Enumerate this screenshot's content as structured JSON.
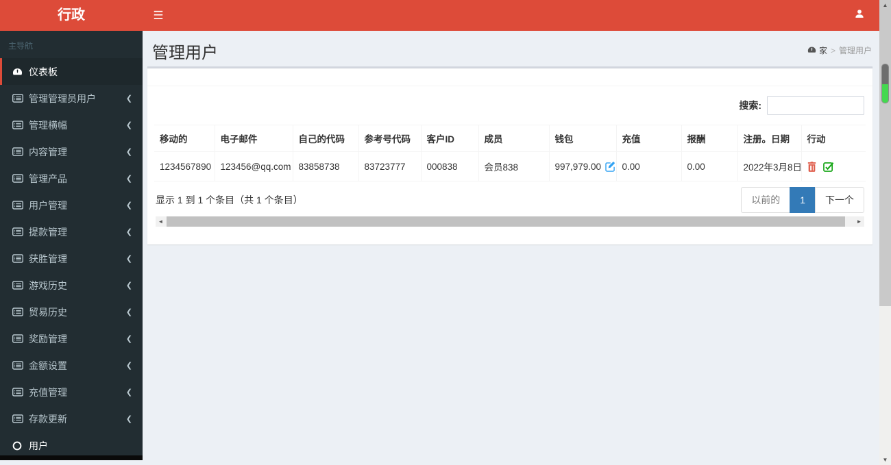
{
  "navbar": {
    "logo": "行政",
    "icons": {
      "menu": "hamburger-icon",
      "user": "user-icon"
    }
  },
  "sidebar": {
    "section_label": "主导航",
    "items": [
      {
        "label": "仪表板",
        "icon": "gauge-icon",
        "active": true,
        "has_children": false
      },
      {
        "label": "管理管理员用户",
        "icon": "list-alt-icon",
        "active": false,
        "has_children": true
      },
      {
        "label": "管理横幅",
        "icon": "list-alt-icon",
        "active": false,
        "has_children": true
      },
      {
        "label": "内容管理",
        "icon": "list-alt-icon",
        "active": false,
        "has_children": true
      },
      {
        "label": "管理产品",
        "icon": "list-alt-icon",
        "active": false,
        "has_children": true
      },
      {
        "label": "用户管理",
        "icon": "list-alt-icon",
        "active": false,
        "has_children": true
      },
      {
        "label": "提款管理",
        "icon": "list-alt-icon",
        "active": false,
        "has_children": true
      },
      {
        "label": "获胜管理",
        "icon": "list-alt-icon",
        "active": false,
        "has_children": true
      },
      {
        "label": "游戏历史",
        "icon": "list-alt-icon",
        "active": false,
        "has_children": true
      },
      {
        "label": "贸易历史",
        "icon": "list-alt-icon",
        "active": false,
        "has_children": true
      },
      {
        "label": "奖励管理",
        "icon": "list-alt-icon",
        "active": false,
        "has_children": true
      },
      {
        "label": "金额设置",
        "icon": "list-alt-icon",
        "active": false,
        "has_children": true
      },
      {
        "label": "充值管理",
        "icon": "list-alt-icon",
        "active": false,
        "has_children": true
      },
      {
        "label": "存款更新",
        "icon": "list-alt-icon",
        "active": false,
        "has_children": true
      },
      {
        "label": "用户",
        "icon": "circle-icon",
        "active": false,
        "has_children": false
      }
    ]
  },
  "content": {
    "page_title": "管理用户",
    "breadcrumb": {
      "home_icon": "gauge-icon",
      "home": "家",
      "separator": ">",
      "current": "管理用户"
    },
    "search": {
      "label": "搜索:",
      "value": ""
    },
    "table": {
      "columns": [
        "移动的",
        "电子邮件",
        "自己的代码",
        "参考号代码",
        "客户ID",
        "成员",
        "钱包",
        "充值",
        "报酬",
        "注册。日期",
        "行动"
      ],
      "row": {
        "mobile": "1234567890",
        "email": "123456@qq.com",
        "own_code": "83858738",
        "ref_code": "83723777",
        "client_id": "000838",
        "member": "会员838",
        "wallet": "997,979.00",
        "recharge": "0.00",
        "reward": "0.00",
        "reg_date": "2022年3月8日"
      },
      "row_action_icons": [
        "trash-icon",
        "check-square-icon"
      ],
      "wallet_icon": "edit-icon"
    },
    "info_text": "显示 1 到 1 个条目（共 1 个条目）",
    "pagination": {
      "previous": "以前的",
      "page": "1",
      "next": "下一个"
    }
  },
  "colors": {
    "accent_red": "#dd4b39",
    "sidebar_bg": "#222d32",
    "sidebar_active_bg": "#1e282c",
    "content_bg": "#ecf0f5",
    "pagination_active": "#337ab7",
    "edit_icon": "#31a2f3",
    "trash_icon": "#e0604f",
    "check_icon": "#1aa71a",
    "scrollbar_green": "#44d94f"
  }
}
